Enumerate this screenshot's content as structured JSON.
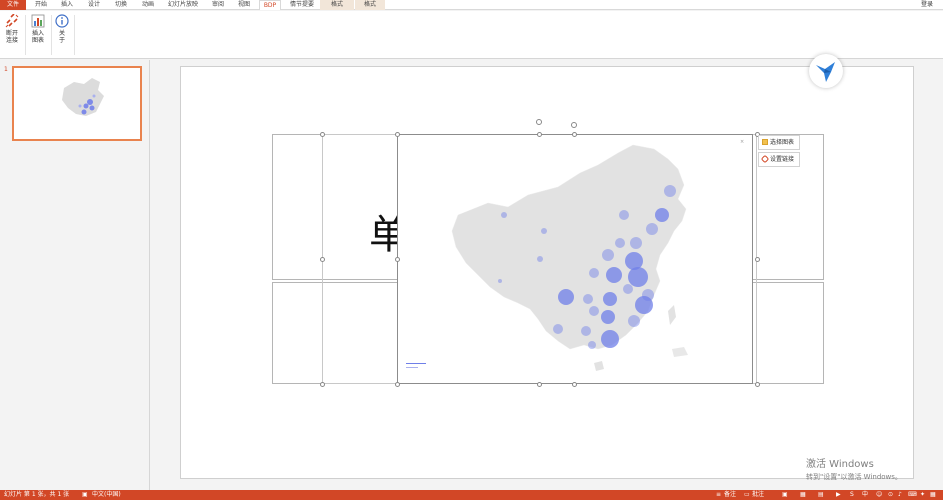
{
  "tabs": [
    {
      "id": "file",
      "label": "文件"
    },
    {
      "id": "home",
      "label": "开始"
    },
    {
      "id": "insert",
      "label": "插入"
    },
    {
      "id": "design",
      "label": "设计"
    },
    {
      "id": "transitions",
      "label": "切换"
    },
    {
      "id": "animations",
      "label": "动画"
    },
    {
      "id": "slideshow",
      "label": "幻灯片放映"
    },
    {
      "id": "review",
      "label": "审阅"
    },
    {
      "id": "view",
      "label": "视图"
    },
    {
      "id": "bdp",
      "label": "BDP"
    },
    {
      "id": "storyboard",
      "label": "情节提要"
    },
    {
      "id": "format1",
      "label": "格式"
    },
    {
      "id": "format2",
      "label": "格式"
    }
  ],
  "login_label": "登录",
  "ribbon": {
    "disconnect": "断开\n连接",
    "insert_chart": "插入\n图表",
    "about": "关\n于"
  },
  "slide_number": "1",
  "slide": {
    "title_char": "单",
    "chart_menu": {
      "select_chart": "选择图表",
      "set_link": "设置链接"
    }
  },
  "status": {
    "slide_info": "幻灯片 第 1 张，共 1 张",
    "language": "中文(中国)",
    "notes": "备注",
    "comments": "批注"
  },
  "watermark": {
    "line1": "激活 Windows",
    "line2": "转到\"设置\"以激活 Windows。"
  },
  "colors": {
    "accent": "#d24726",
    "bubble": "#6f7fe8",
    "map": "#e2e2e2"
  }
}
